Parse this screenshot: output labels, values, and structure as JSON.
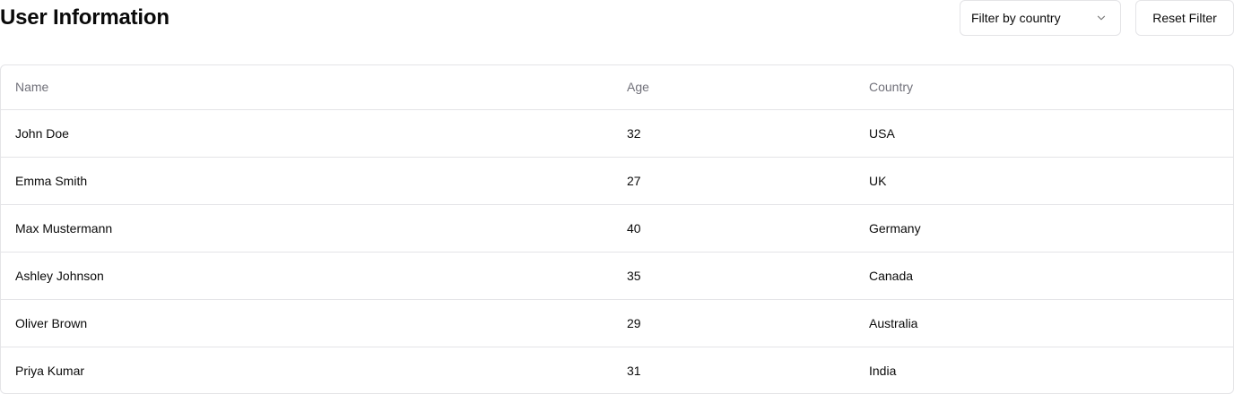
{
  "header": {
    "title": "User Information"
  },
  "filter": {
    "label": "Filter by country",
    "icon": "chevron-down-icon"
  },
  "reset": {
    "label": "Reset Filter"
  },
  "table": {
    "columns": [
      "Name",
      "Age",
      "Country"
    ],
    "rows": [
      {
        "name": "John Doe",
        "age": "32",
        "country": "USA"
      },
      {
        "name": "Emma Smith",
        "age": "27",
        "country": "UK"
      },
      {
        "name": "Max Mustermann",
        "age": "40",
        "country": "Germany"
      },
      {
        "name": "Ashley Johnson",
        "age": "35",
        "country": "Canada"
      },
      {
        "name": "Oliver Brown",
        "age": "29",
        "country": "Australia"
      },
      {
        "name": "Priya Kumar",
        "age": "31",
        "country": "India"
      }
    ]
  },
  "colors": {
    "border": "#e4e4e7",
    "muted_text": "#71717a",
    "text": "#0a0a0a"
  }
}
